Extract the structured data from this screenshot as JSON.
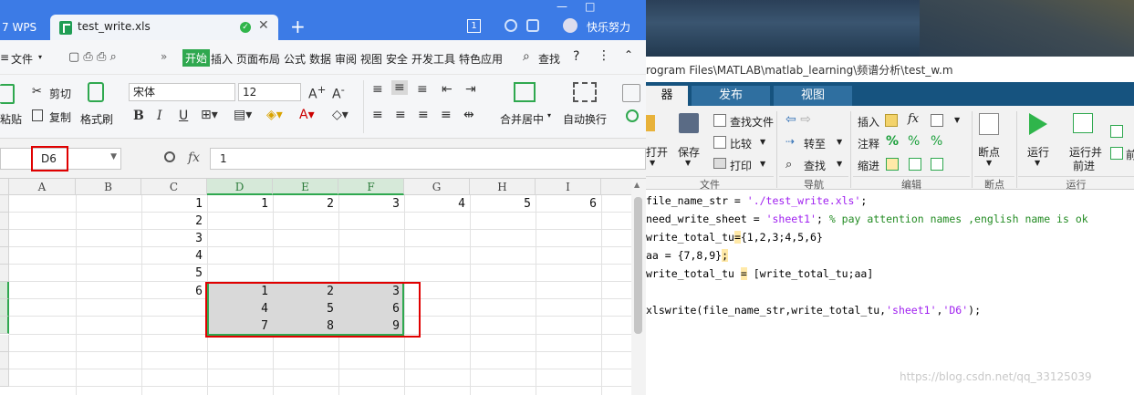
{
  "wps": {
    "app_tab": "7 WPS",
    "doc_tab": "test_write.xls",
    "new_tab": "+",
    "badge": "1",
    "user": "快乐努力",
    "menus": [
      "文件",
      "开始",
      "插入",
      "页面布局",
      "公式",
      "数据",
      "审阅",
      "视图",
      "安全",
      "开发工具",
      "特色应用"
    ],
    "search": "查找",
    "help": "?",
    "ribbon": {
      "paste": "粘贴",
      "cut": "剪切",
      "copy": "复制",
      "format_painter": "格式刷",
      "font_name": "宋体",
      "font_size": "12",
      "bold": "B",
      "italic": "I",
      "underline": "U",
      "merge_center": "合并居中",
      "wrap_text": "自动换行"
    },
    "name_box": "D6",
    "formula_value": "1",
    "columns": [
      "A",
      "B",
      "C",
      "D",
      "E",
      "F",
      "G",
      "H",
      "I"
    ],
    "rows": [
      {
        "c": "1",
        "d": "1",
        "e": "2",
        "f": "3",
        "g": "4",
        "h": "5",
        "i": "6"
      },
      {
        "c": "2"
      },
      {
        "c": "3"
      },
      {
        "c": "4"
      },
      {
        "c": "5"
      },
      {
        "c": "6",
        "d": "1",
        "e": "2",
        "f": "3"
      },
      {
        "d": "4",
        "e": "5",
        "f": "6"
      },
      {
        "d": "7",
        "e": "8",
        "f": "9"
      }
    ]
  },
  "matlab": {
    "path": "rogram Files\\MATLAB\\matlab_learning\\频谱分析\\test_w.m",
    "tabs": [
      "器",
      "发布",
      "视图"
    ],
    "toolstrip": {
      "open": "打开",
      "save": "保存",
      "find_files": "查找文件",
      "compare": "比较",
      "print": "打印",
      "goto": "转至",
      "find": "查找",
      "insert": "插入",
      "comment": "注释",
      "indent": "缩进",
      "fx": "fx",
      "breakpoints": "断点",
      "run": "运行",
      "run_advance": "运行并",
      "advance": "前进",
      "groups": [
        "文件",
        "导航",
        "编辑",
        "断点",
        "运行"
      ]
    },
    "code": [
      {
        "plain": "file_name_str = ",
        "str": "'./test_write.xls'",
        "tail": ";"
      },
      {
        "plain": "need_write_sheet = ",
        "str": "'sheet1'",
        "tail": "; ",
        "cmt": "% pay attention names ,english name is ok"
      },
      {
        "plain": "write_total_tu",
        "hl": "=",
        "tail2": "{1,2,3;4,5,6}"
      },
      {
        "plain": "aa = {7,8,9}",
        "hl": ";"
      },
      {
        "plain": "write_total_tu ",
        "hl": "=",
        "tail2": " [write_total_tu;aa]"
      },
      {
        "plain": ""
      },
      {
        "plain": "xlswrite(file_name_str,write_total_tu,",
        "str": "'sheet1'",
        "mid": ",",
        "str2": "'D6'",
        "tail": ");"
      }
    ],
    "watermark": "https://blog.csdn.net/qq_33125039"
  }
}
